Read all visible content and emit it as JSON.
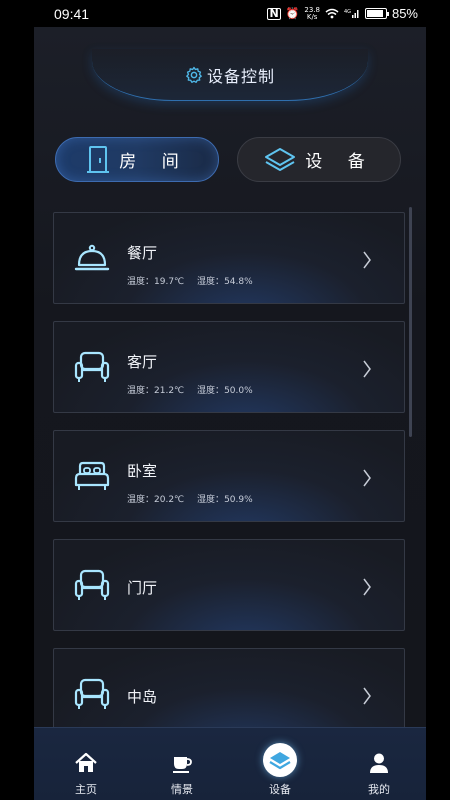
{
  "status": {
    "time": "09:41",
    "net_speed_top": "23.8",
    "net_speed_bottom": "K/s",
    "battery": "85%"
  },
  "header": {
    "title": "设备控制"
  },
  "tabs": [
    {
      "label": "房 间",
      "active": true
    },
    {
      "label": "设 备",
      "active": false
    }
  ],
  "rooms": [
    {
      "name": "餐厅",
      "icon": "dining-cloche-icon",
      "temp_label": "温度：",
      "temp": "19.7℃",
      "hum_label": "湿度：",
      "hum": "54.8%"
    },
    {
      "name": "客厅",
      "icon": "sofa-icon",
      "temp_label": "温度：",
      "temp": "21.2℃",
      "hum_label": "湿度：",
      "hum": "50.0%"
    },
    {
      "name": "卧室",
      "icon": "bed-icon",
      "temp_label": "温度：",
      "temp": "20.2℃",
      "hum_label": "湿度：",
      "hum": "50.9%"
    },
    {
      "name": "门厅",
      "icon": "sofa-icon"
    },
    {
      "name": "中岛",
      "icon": "sofa-icon"
    }
  ],
  "nav": [
    {
      "label": "主页",
      "icon": "home-icon"
    },
    {
      "label": "情景",
      "icon": "cup-icon"
    },
    {
      "label": "设备",
      "icon": "layers-icon",
      "active": true
    },
    {
      "label": "我的",
      "icon": "user-icon"
    }
  ],
  "colors": {
    "accent": "#4fb8e8",
    "tab_active": "#1d3b6a",
    "background": "#14151b",
    "nav_bg": "#1a2740"
  }
}
